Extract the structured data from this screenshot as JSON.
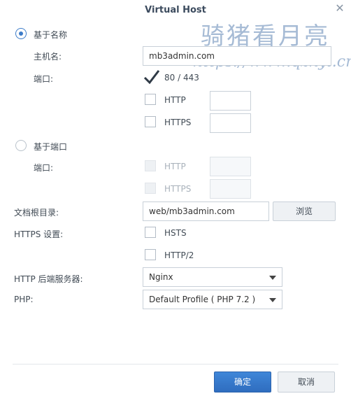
{
  "dialog": {
    "title": "Virtual Host",
    "close_symbol": "✕"
  },
  "watermark": {
    "text_cn": "骑猪看月亮",
    "url": "https://www.qzkyl.cn"
  },
  "name_mode": {
    "radio_label": "基于名称",
    "selected": true,
    "hostname_label": "主机名:",
    "hostname_value": "mb3admin.com",
    "port_label": "端口:",
    "default_ports_label": "80 / 443",
    "default_ports_checked": true,
    "http_label": "HTTP",
    "http_port": "",
    "https_label": "HTTPS",
    "https_port": ""
  },
  "port_mode": {
    "radio_label": "基于端口",
    "selected": false,
    "port_label": "端口:",
    "http_label": "HTTP",
    "http_port": "",
    "https_label": "HTTPS",
    "https_port": ""
  },
  "docroot": {
    "label": "文档根目录:",
    "value": "web/mb3admin.com",
    "browse_label": "浏览"
  },
  "https_settings": {
    "label": "HTTPS 设置:",
    "hsts_label": "HSTS",
    "http2_label": "HTTP/2"
  },
  "backend": {
    "label": "HTTP 后端服务器:",
    "value": "Nginx"
  },
  "php": {
    "label": "PHP:",
    "value": "Default Profile ( PHP 7.2 )"
  },
  "footer": {
    "ok_label": "确定",
    "cancel_label": "取消"
  },
  "colors": {
    "accent": "#3d7cc9",
    "primary_button": "#2f6dbf"
  },
  "icons": {
    "close": "close-icon",
    "check": "checkmark-icon",
    "dropdown": "chevron-down-icon"
  }
}
